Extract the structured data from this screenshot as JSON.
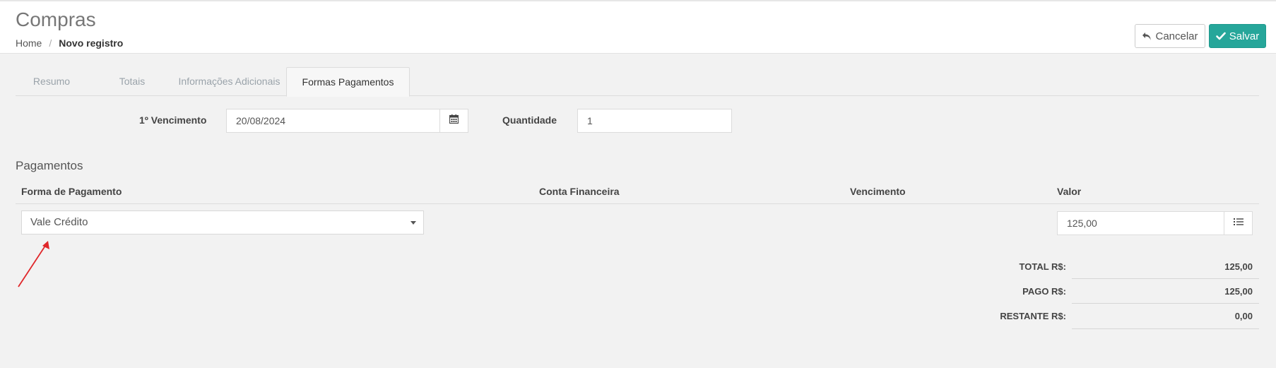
{
  "header": {
    "title": "Compras",
    "breadcrumb": {
      "home": "Home",
      "separator": "/",
      "current": "Novo registro"
    },
    "cancel_label": "Cancelar",
    "save_label": "Salvar"
  },
  "tabs": [
    {
      "label": "Resumo",
      "active": false
    },
    {
      "label": "Totais",
      "active": false
    },
    {
      "label": "Informações Adicionais",
      "active": false
    },
    {
      "label": "Formas Pagamentos",
      "active": true
    }
  ],
  "form": {
    "first_due_label": "1º Vencimento",
    "first_due_value": "20/08/2024",
    "quantity_label": "Quantidade",
    "quantity_value": "1"
  },
  "payments": {
    "title": "Pagamentos",
    "columns": [
      "Forma de Pagamento",
      "Conta Financeira",
      "Vencimento",
      "Valor"
    ],
    "rows": [
      {
        "method": "Vale Crédito",
        "account": "",
        "due": "",
        "value": "125,00"
      }
    ]
  },
  "totals": [
    {
      "label": "TOTAL R$:",
      "value": "125,00"
    },
    {
      "label": "PAGO R$:",
      "value": "125,00"
    },
    {
      "label": "RESTANTE R$:",
      "value": "0,00"
    }
  ],
  "colors": {
    "accent": "#26a69a",
    "background": "#f2f2f2",
    "annotation_arrow": "#e0272a"
  },
  "icons": [
    "undo-icon",
    "check-icon",
    "calendar-icon",
    "list-icon",
    "chevron-down-icon"
  ]
}
